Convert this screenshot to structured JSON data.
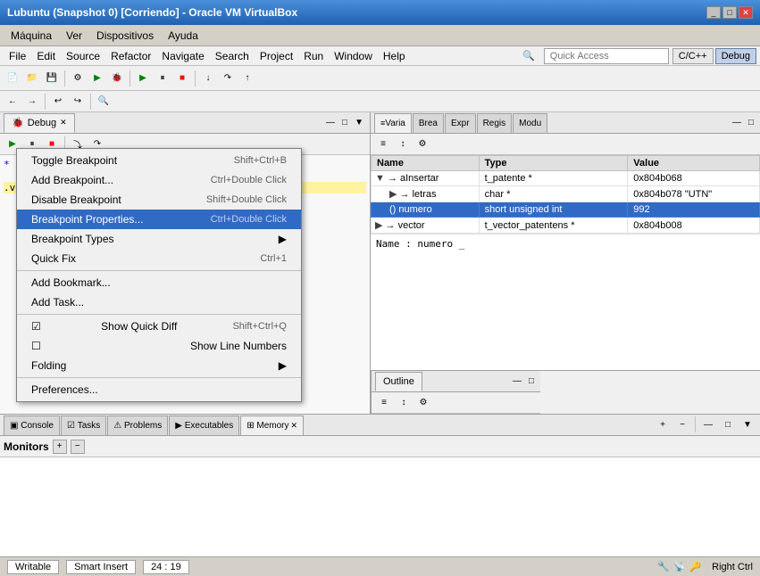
{
  "window": {
    "title": "Lubuntu (Snapshot 0) [Corriendo] - Oracle VM VirtualBox",
    "vm_menu": [
      "Máquina",
      "Ver",
      "Dispositivos",
      "Ayuda"
    ],
    "controls": [
      "_",
      "□",
      "✕"
    ]
  },
  "eclipse": {
    "menubar": [
      "File",
      "Edit",
      "Source",
      "Refactor",
      "Navigate",
      "Search",
      "Project",
      "Run",
      "Window",
      "Help"
    ],
    "quick_access_placeholder": "Quick Access",
    "perspectives": [
      "C/C++",
      "Debug"
    ]
  },
  "debug_panel": {
    "tab_label": "Debug",
    "tab_close": "✕"
  },
  "context_menu": {
    "items": [
      {
        "label": "Toggle Breakpoint",
        "shortcut": "Shift+Ctrl+B",
        "type": "normal",
        "has_arrow": false
      },
      {
        "label": "Add Breakpoint...",
        "shortcut": "Ctrl+Double Click",
        "type": "normal",
        "has_arrow": false
      },
      {
        "label": "Disable Breakpoint",
        "shortcut": "Shift+Double Click",
        "type": "normal",
        "has_arrow": false
      },
      {
        "label": "Breakpoint Properties...",
        "shortcut": "Ctrl+Double Click",
        "type": "selected",
        "has_arrow": false
      },
      {
        "label": "Breakpoint Types",
        "shortcut": "",
        "type": "normal",
        "has_arrow": true
      },
      {
        "label": "Quick Fix",
        "shortcut": "Ctrl+1",
        "type": "normal",
        "has_arrow": false
      },
      {
        "label": "Add Bookmark...",
        "shortcut": "",
        "type": "normal",
        "has_arrow": false
      },
      {
        "label": "Add Task...",
        "shortcut": "",
        "type": "normal",
        "has_arrow": false
      },
      {
        "label": "Show Quick Diff",
        "shortcut": "Shift+Ctrl+Q",
        "type": "checkbox_checked",
        "has_arrow": false
      },
      {
        "label": "Show Line Numbers",
        "shortcut": "",
        "type": "checkbox",
        "has_arrow": false
      },
      {
        "label": "Folding",
        "shortcut": "",
        "type": "normal",
        "has_arrow": true
      },
      {
        "label": "Preferences...",
        "shortcut": "",
        "type": "normal",
        "has_arrow": false
      }
    ]
  },
  "variables_panel": {
    "tabs": [
      "Varia",
      "Brea",
      "Expr",
      "Regis",
      "Modu"
    ],
    "columns": [
      "Name",
      "Type",
      "Value"
    ],
    "rows": [
      {
        "indent": 0,
        "arrow": "▼",
        "icon": "→",
        "name": "aInsertar",
        "type": "t_patente *",
        "value": "0x804b068",
        "selected": false
      },
      {
        "indent": 1,
        "arrow": "▶",
        "icon": "→",
        "name": "letras",
        "type": "char *",
        "value": "0x804b078 \"UTN\"",
        "selected": false
      },
      {
        "indent": 1,
        "arrow": "",
        "icon": "()",
        "name": "numero",
        "type": "short unsigned int",
        "value": "992",
        "selected": true
      },
      {
        "indent": 0,
        "arrow": "▶",
        "icon": "→",
        "name": "vector",
        "type": "t_vector_patentens *",
        "value": "0x804b008",
        "selected": false
      }
    ],
    "name_label": "Name : numero _"
  },
  "outline_panel": {
    "tab_label": "Outline"
  },
  "code_area": {
    "lines": [
      "* x){",
      "",
      ".vector[i]->letras, x->vector[i]-"
    ]
  },
  "bottom_tabs": [
    "Console",
    "Tasks",
    "Problems",
    "Executables",
    "Memory"
  ],
  "bottom_active_tab": "Memory",
  "bottom_content": {
    "monitors_label": "Monitors"
  },
  "status_bar": {
    "writable": "Writable",
    "insert_mode": "Smart Insert",
    "position": "24 : 19"
  },
  "taskbar": {
    "right_ctrl": "Right Ctrl"
  }
}
